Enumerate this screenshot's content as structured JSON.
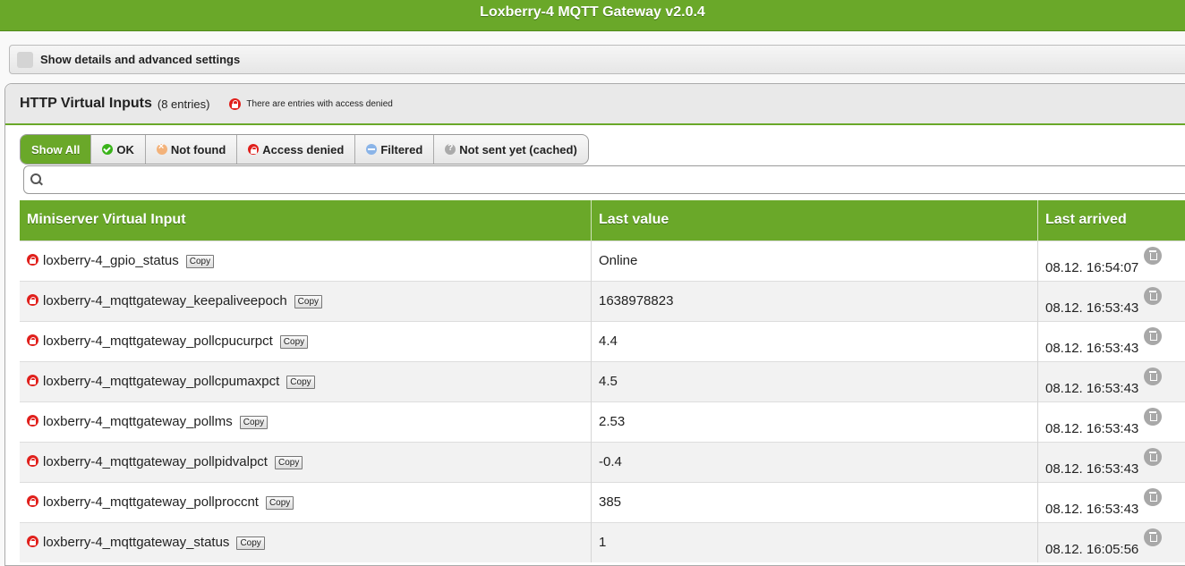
{
  "app": {
    "title": "Loxberry-4 MQTT Gateway v2.0.4"
  },
  "details": {
    "label": "Show details and advanced settings"
  },
  "panel": {
    "title": "HTTP Virtual Inputs",
    "count": "(8 entries)",
    "warning": "There are entries with access denied"
  },
  "filters": {
    "show_all": "Show All",
    "ok": "OK",
    "not_found": "Not found",
    "access_denied": "Access denied",
    "filtered": "Filtered",
    "not_sent": "Not sent yet (cached)"
  },
  "search": {
    "value": "",
    "placeholder": ""
  },
  "table": {
    "headers": {
      "name": "Miniserver Virtual Input",
      "value": "Last value",
      "arrived": "Last arrived"
    },
    "copy_label": "Copy",
    "rows": [
      {
        "name": "loxberry-4_gpio_status",
        "value": "Online",
        "arrived": "08.12. 16:54:07"
      },
      {
        "name": "loxberry-4_mqttgateway_keepaliveepoch",
        "value": "1638978823",
        "arrived": "08.12. 16:53:43"
      },
      {
        "name": "loxberry-4_mqttgateway_pollcpucurpct",
        "value": "4.4",
        "arrived": "08.12. 16:53:43"
      },
      {
        "name": "loxberry-4_mqttgateway_pollcpumaxpct",
        "value": "4.5",
        "arrived": "08.12. 16:53:43"
      },
      {
        "name": "loxberry-4_mqttgateway_pollms",
        "value": "2.53",
        "arrived": "08.12. 16:53:43"
      },
      {
        "name": "loxberry-4_mqttgateway_pollpidvalpct",
        "value": "-0.4",
        "arrived": "08.12. 16:53:43"
      },
      {
        "name": "loxberry-4_mqttgateway_pollproccnt",
        "value": "385",
        "arrived": "08.12. 16:53:43"
      },
      {
        "name": "loxberry-4_mqttgateway_status",
        "value": "1",
        "arrived": "08.12. 16:05:56"
      }
    ]
  }
}
